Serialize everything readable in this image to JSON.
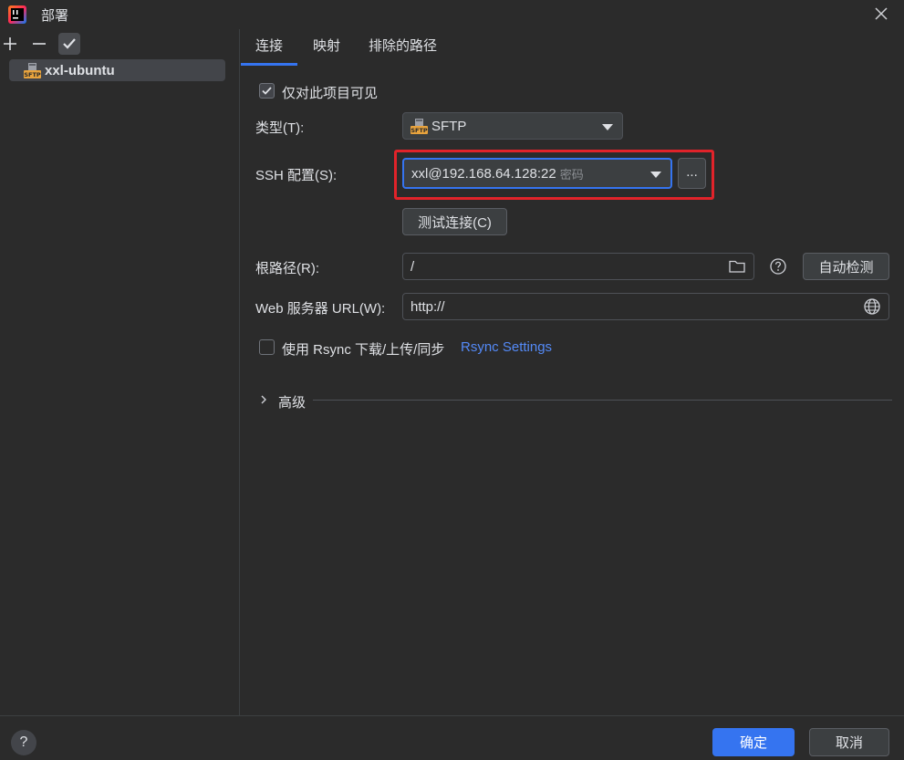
{
  "window": {
    "title": "部署",
    "app_icon": "intellij-icon",
    "close_icon": "close-icon"
  },
  "toolbar": {
    "add_icon": "plus-icon",
    "remove_icon": "minus-icon",
    "default_icon": "checkmark-icon"
  },
  "servers": [
    {
      "name": "xxl-ubuntu",
      "badge": "SFTP"
    }
  ],
  "tabs": [
    {
      "label": "连接",
      "active": true
    },
    {
      "label": "映射",
      "active": false
    },
    {
      "label": "排除的路径",
      "active": false
    }
  ],
  "form": {
    "visible_only_label": "仅对此项目可见",
    "visible_only_checked": true,
    "type_label": "类型(T):",
    "type_value": "SFTP",
    "type_badge": "SFTP",
    "ssh_label": "SSH 配置(S):",
    "ssh_value": "xxl@192.168.64.128:22",
    "ssh_hint": "密码",
    "ssh_more_label": "...",
    "test_button": "测试连接(C)",
    "root_label": "根路径(R):",
    "root_value": "/",
    "autodetect_button": "自动检测",
    "web_url_label": "Web 服务器 URL(W):",
    "web_url_value": "http://",
    "rsync_label": "使用 Rsync 下载/上传/同步",
    "rsync_checked": false,
    "rsync_settings_link": "Rsync Settings",
    "advanced_label": "高级"
  },
  "footer": {
    "help_label": "?",
    "ok_button": "确定",
    "cancel_button": "取消"
  },
  "colors": {
    "background": "#2b2b2b",
    "accent": "#3574f0",
    "link": "#548af7",
    "highlight": "#e1232a",
    "sftp_badge": "#e8a33d"
  }
}
